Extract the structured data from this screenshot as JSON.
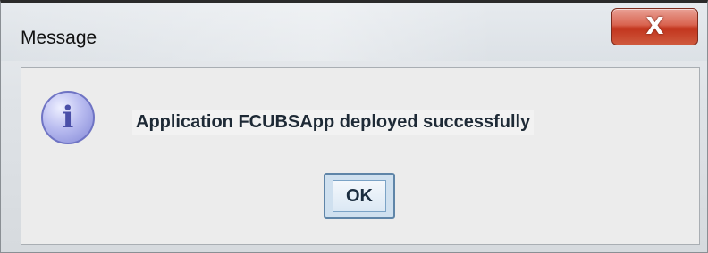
{
  "window": {
    "title": "Message",
    "close_icon": "close-icon",
    "close_glyph": "X"
  },
  "dialog": {
    "icon": "info-icon",
    "icon_glyph": "i",
    "message": "Application FCUBSApp deployed successfully",
    "ok_label": "OK"
  },
  "colors": {
    "close_button": "#c2351d",
    "info_icon": "#8287d6",
    "ok_border": "#5f85a8"
  }
}
